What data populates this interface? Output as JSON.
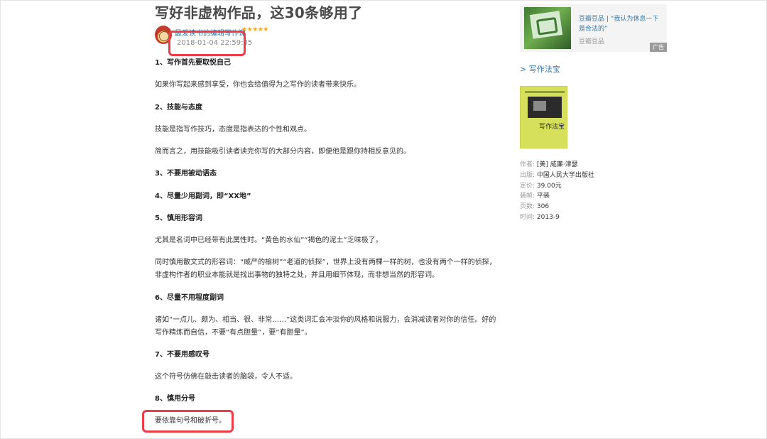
{
  "article": {
    "title": "写好非虚构作品，这30条够用了",
    "author_line": "最爱读书的编辑写作课",
    "stars": "★★★★★",
    "timestamp": "2018-01-04 22:59:35",
    "paragraphs": [
      {
        "kind": "heading",
        "text": " 1、写作首先要取悦自己"
      },
      {
        "kind": "body",
        "text": "如果你写起来感到享受，你也会给值得为之写作的读者带来快乐。"
      },
      {
        "kind": "heading",
        "text": "2、技能与态度"
      },
      {
        "kind": "body",
        "text": "技能是指写作技巧，态度是指表达的个性和观点。"
      },
      {
        "kind": "body",
        "text": "简而言之，用技能吸引读者读完你写的大部分内容，即便他是跟你持相反意见的。"
      },
      {
        "kind": "heading",
        "text": "3、不要用被动语态"
      },
      {
        "kind": "heading",
        "text": "4、尽量少用副词，即“XX地”"
      },
      {
        "kind": "heading",
        "text": "5、慎用形容词"
      },
      {
        "kind": "body",
        "text": "尤其是名词中已经带有此属性时。“黄色的水仙”“褐色的泥土”乏味极了。"
      },
      {
        "kind": "body",
        "text": "同时慎用散文式的形容词：“威严的榆树”“老道的侦探”，世界上没有两棵一样的树，也没有两个一样的侦探，"
      },
      {
        "kind": "body",
        "text": "非虚构作者的职业本能就是找出事物的独特之处，并且用细节体现，而非想当然的形容词。"
      },
      {
        "kind": "heading",
        "text": "6、尽量不用程度副词"
      },
      {
        "kind": "body",
        "text": "诸如“一点儿、颇为、相当、很、非常……”这类词汇会冲淡你的风格和说服力，会消减读者对你的信任。好的"
      },
      {
        "kind": "body",
        "text": "写作精炼而自信，不要“有点胆量”，要“有胆量”。"
      },
      {
        "kind": "heading",
        "text": "7、不要用感叹号"
      },
      {
        "kind": "body",
        "text": "这个符号仿佛在敲击读者的脑袋，令人不适。"
      },
      {
        "kind": "heading",
        "text": "8、慎用分号"
      },
      {
        "kind": "body",
        "text": "要依靠句号和破折号。"
      }
    ]
  },
  "sidebar": {
    "ad": {
      "title": "豆瓣豆品 | “我认为休息一下是合法的”",
      "source": "豆瓣豆品",
      "badge": "广告"
    },
    "book": {
      "link": "> 写作法宝",
      "cover_title": "写作法宝",
      "meta": [
        {
          "key": "作者:",
          "value": "[美] 威廉·津瑟"
        },
        {
          "key": "出版:",
          "value": "中国人民大学出版社"
        },
        {
          "key": "定价:",
          "value": "39.00元"
        },
        {
          "key": "装帧:",
          "value": "平装"
        },
        {
          "key": "页数:",
          "value": "306"
        },
        {
          "key": "时间:",
          "value": "2013-9"
        }
      ]
    }
  },
  "colors": {
    "highlight": "#ee3b48",
    "link": "#3377aa",
    "star": "#f5a623"
  }
}
